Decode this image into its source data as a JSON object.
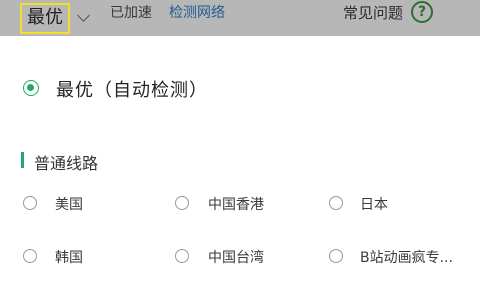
{
  "header": {
    "current_route": "最优",
    "accel_status": "已加速",
    "detect_link": "检测网络",
    "faq_label": "常见问题",
    "help_icon": "help-circle-icon",
    "help_glyph": "?"
  },
  "sheet": {
    "optimal_option": {
      "label": "最优（自动检测）",
      "selected": true
    },
    "section_title": "普通线路",
    "options": [
      {
        "label": "美国",
        "selected": false
      },
      {
        "label": "中国香港",
        "selected": false
      },
      {
        "label": "日本",
        "selected": false
      },
      {
        "label": "韩国",
        "selected": false
      },
      {
        "label": "中国台湾",
        "selected": false
      },
      {
        "label": "B站动画疯专...",
        "selected": false
      }
    ]
  },
  "colors": {
    "accent_green": "#25a86b",
    "highlight_yellow": "#f2df2a",
    "link_blue": "#215c8f",
    "dimmed_header": "#b7b7b7"
  }
}
